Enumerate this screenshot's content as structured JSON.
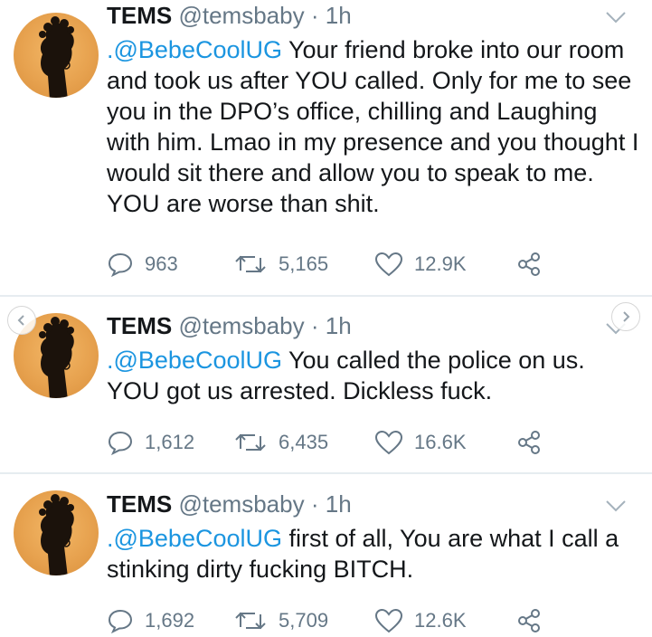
{
  "tweets": [
    {
      "name": "TEMS",
      "handle": "@temsbaby",
      "dot": "·",
      "time": "1h",
      "mention": ".@BebeCoolUG",
      "text": " Your friend broke into our room and took us after YOU called. Only for me to see you in the DPO’s office, chilling and Laughing with him. Lmao in my presence and you thought I would sit there and allow you to speak to me. YOU are worse than shit.",
      "replies": "963",
      "retweets": "5,165",
      "likes": "12.9K"
    },
    {
      "name": "TEMS",
      "handle": "@temsbaby",
      "dot": "·",
      "time": "1h",
      "mention": ".@BebeCoolUG",
      "text": " You called the police on us. YOU got us arrested. Dickless fuck.",
      "replies": "1,612",
      "retweets": "6,435",
      "likes": "16.6K"
    },
    {
      "name": "TEMS",
      "handle": "@temsbaby",
      "dot": "·",
      "time": "1h",
      "mention": ".@BebeCoolUG",
      "text": " first of all, You are what I call a stinking dirty fucking BITCH.",
      "replies": "1,692",
      "retweets": "5,709",
      "likes": "12.6K"
    }
  ],
  "carousel": {
    "prev_icon": "chevron-left-icon",
    "next_icon": "chevron-right-icon"
  },
  "colors": {
    "mention": "#1b95e0",
    "secondary": "#657786",
    "text": "#14171a"
  }
}
